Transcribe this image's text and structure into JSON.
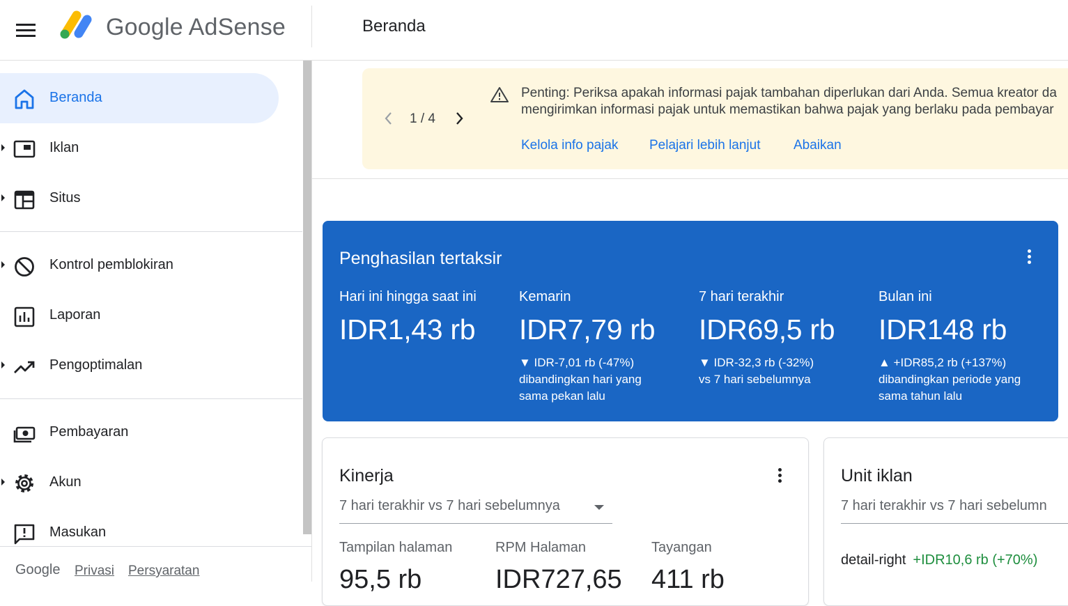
{
  "header": {
    "brand": "Google AdSense",
    "page_title": "Beranda"
  },
  "sidebar": {
    "items": [
      {
        "label": "Beranda",
        "icon": "home-icon"
      },
      {
        "label": "Iklan",
        "icon": "ad-unit-icon"
      },
      {
        "label": "Situs",
        "icon": "sites-icon"
      },
      {
        "label": "Kontrol pemblokiran",
        "icon": "block-icon"
      },
      {
        "label": "Laporan",
        "icon": "bar-chart-icon"
      },
      {
        "label": "Pengoptimalan",
        "icon": "trending-up-icon"
      },
      {
        "label": "Pembayaran",
        "icon": "payments-icon"
      },
      {
        "label": "Akun",
        "icon": "gear-icon"
      },
      {
        "label": "Masukan",
        "icon": "feedback-icon"
      }
    ],
    "footer": {
      "google": "Google",
      "privacy": "Privasi",
      "terms": "Persyaratan"
    }
  },
  "banner": {
    "pager": "1 / 4",
    "line1": "Penting: Periksa apakah informasi pajak tambahan diperlukan dari Anda. Semua kreator da",
    "line2": "mengirimkan informasi pajak untuk memastikan bahwa pajak yang berlaku pada pembayar",
    "links": [
      "Kelola info pajak",
      "Pelajari lebih lanjut",
      "Abaikan"
    ]
  },
  "earnings": {
    "title": "Penghasilan tertaksir",
    "metrics": [
      {
        "label": "Hari ini hingga saat ini",
        "value": "IDR1,43 rb",
        "delta1": "",
        "delta2": "",
        "delta3": ""
      },
      {
        "label": "Kemarin",
        "value": "IDR7,79 rb",
        "delta1": "▼ IDR-7,01 rb (-47%)",
        "delta2": "dibandingkan hari yang",
        "delta3": "sama pekan lalu"
      },
      {
        "label": "7 hari terakhir",
        "value": "IDR69,5 rb",
        "delta1": "▼ IDR-32,3 rb (-32%)",
        "delta2": "vs 7 hari sebelumnya",
        "delta3": ""
      },
      {
        "label": "Bulan ini",
        "value": "IDR148 rb",
        "delta1": "▲ +IDR85,2 rb (+137%)",
        "delta2": "dibandingkan periode yang",
        "delta3": "sama tahun lalu"
      }
    ]
  },
  "kinerja": {
    "title": "Kinerja",
    "period": "7 hari terakhir vs 7 hari sebelumnya",
    "stats": [
      {
        "label": "Tampilan halaman",
        "value": "95,5 rb"
      },
      {
        "label": "RPM Halaman",
        "value": "IDR727,65"
      },
      {
        "label": "Tayangan",
        "value": "411 rb"
      }
    ]
  },
  "unit_iklan": {
    "title": "Unit iklan",
    "period": "7 hari terakhir vs 7 hari sebelumn",
    "row_name": "detail-right",
    "row_delta": "+IDR10,6 rb (+70%)"
  },
  "colors": {
    "accent": "#1a73e8",
    "earnings_card": "#1a66c4",
    "banner_bg": "#fef7e0",
    "active_nav_bg": "#e8f0fe",
    "positive": "#1e8e3e"
  }
}
